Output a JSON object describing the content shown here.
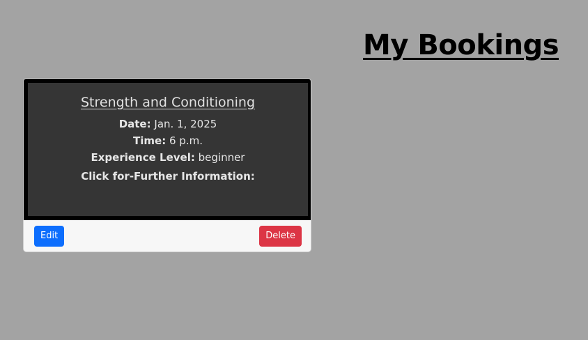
{
  "header": {
    "title": "My Bookings"
  },
  "bookings": [
    {
      "class_name": "Strength and Conditioning",
      "date_label": "Date:",
      "date_value": "Jan. 1, 2025",
      "time_label": "Time:",
      "time_value": "6 p.m.",
      "level_label": "Experience Level:",
      "level_value": "beginner",
      "further_info": "Click for-Further Information:",
      "edit_label": "Edit",
      "delete_label": "Delete"
    }
  ],
  "colors": {
    "page_background": "#a3a3a3",
    "card_body": "#353535",
    "edit_button": "#0d6efd",
    "delete_button": "#dc3545"
  }
}
